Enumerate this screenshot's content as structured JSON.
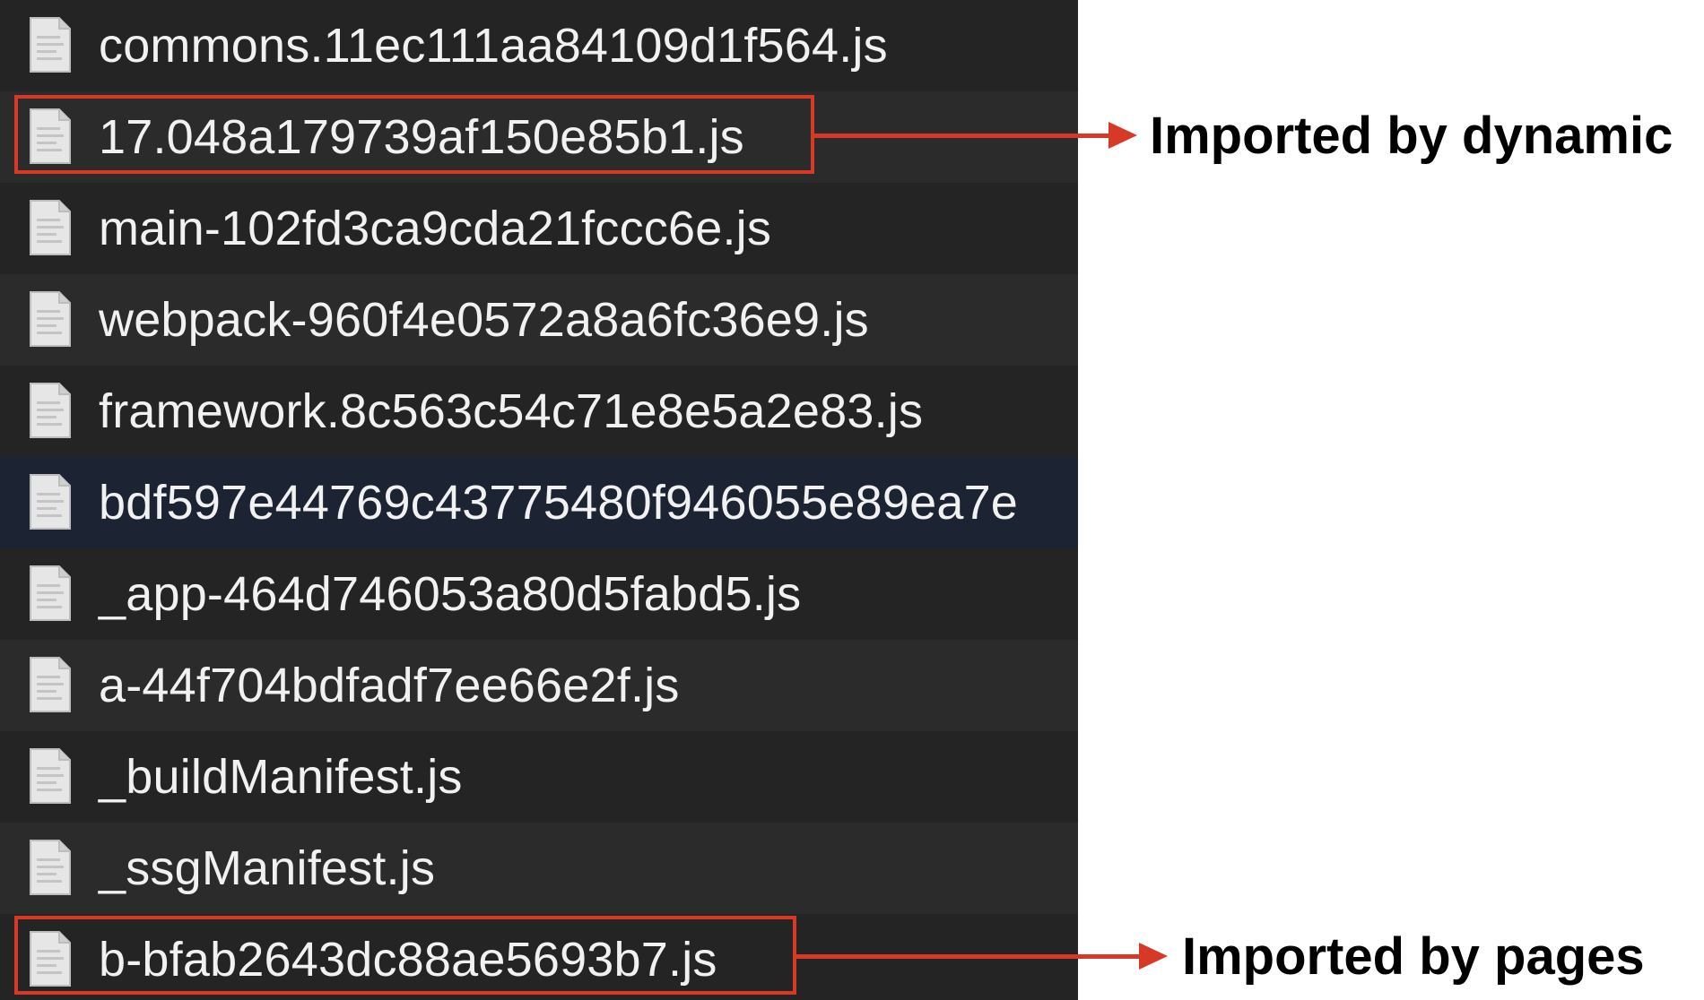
{
  "colors": {
    "panel_background": "#242424",
    "row_alt_background": "#2b2b2b",
    "row_selected_background": "#1c2333",
    "file_text": "#f1f1f1",
    "annotation_red": "#d63a26",
    "annotation_text": "#000000"
  },
  "files": [
    {
      "name": "commons.11ec111aa84109d1f564.js",
      "icon": "document-icon"
    },
    {
      "name": "17.048a179739af150e85b1.js",
      "icon": "document-icon"
    },
    {
      "name": "main-102fd3ca9cda21fccc6e.js",
      "icon": "document-icon"
    },
    {
      "name": "webpack-960f4e0572a8a6fc36e9.js",
      "icon": "document-icon"
    },
    {
      "name": "framework.8c563c54c71e8e5a2e83.js",
      "icon": "document-icon"
    },
    {
      "name": "bdf597e44769c43775480f946055e89ea7e",
      "icon": "document-icon",
      "selected": true
    },
    {
      "name": "_app-464d746053a80d5fabd5.js",
      "icon": "document-icon"
    },
    {
      "name": "a-44f704bdfadf7ee66e2f.js",
      "icon": "document-icon"
    },
    {
      "name": "_buildManifest.js",
      "icon": "document-icon"
    },
    {
      "name": "_ssgManifest.js",
      "icon": "document-icon"
    },
    {
      "name": "b-bfab2643dc88ae5693b7.js",
      "icon": "document-icon"
    }
  ],
  "annotations": {
    "dynamic": {
      "label": "Imported by dynamic",
      "file": "17.048a179739af150e85b1.js"
    },
    "pages": {
      "label": "Imported by pages",
      "file": "b-bfab2643dc88ae5693b7.js"
    }
  }
}
